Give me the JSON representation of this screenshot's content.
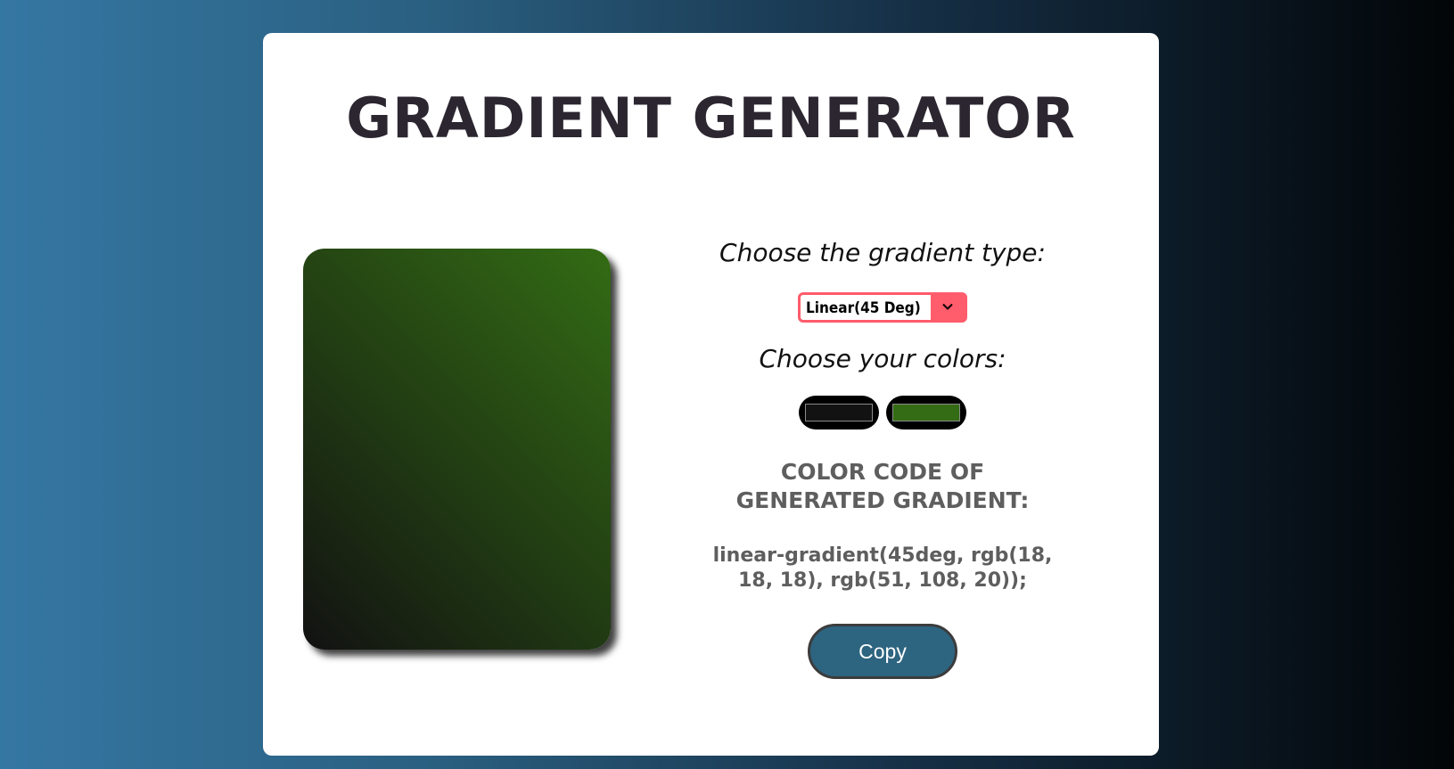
{
  "app": {
    "title": "GRADIENT GENERATOR"
  },
  "preview": {
    "gradient_type": "linear",
    "angle_deg": 45,
    "color_start": "#121212",
    "color_end": "#336c14"
  },
  "controls": {
    "type_label": "Choose the gradient type:",
    "type_select": {
      "selected": "Linear(45 Deg)"
    },
    "colors_label": "Choose your colors:",
    "color_inputs": [
      {
        "value": "#121212"
      },
      {
        "value": "#336c14"
      }
    ],
    "code_heading": "COLOR CODE OF GENERATED GRADIENT:",
    "code_value": "linear-gradient(45deg, rgb(18, 18, 18), rgb(51, 108, 20));",
    "copy_label": "Copy"
  },
  "theme": {
    "select_accent": "#ff5c6c",
    "button_color": "#2d6480",
    "card_background": "#ffffff"
  },
  "icons": {
    "select_arrow": "chevron-down-icon"
  }
}
